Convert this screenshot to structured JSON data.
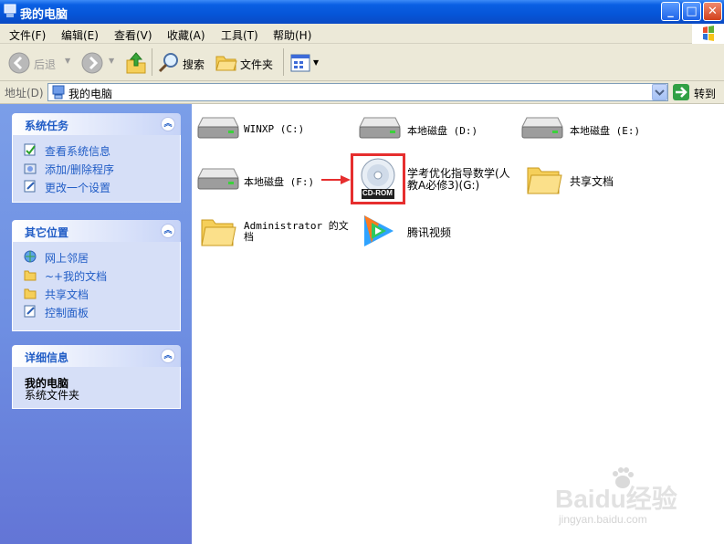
{
  "window": {
    "title": "我的电脑"
  },
  "menu": [
    "文件(F)",
    "编辑(E)",
    "查看(V)",
    "收藏(A)",
    "工具(T)",
    "帮助(H)"
  ],
  "toolbar": {
    "back": "后退",
    "search": "搜索",
    "folders": "文件夹"
  },
  "address": {
    "label": "地址(D)",
    "value": "我的电脑",
    "go": "转到"
  },
  "left": {
    "tasks": {
      "title": "系统任务",
      "items": [
        "查看系统信息",
        "添加/删除程序",
        "更改一个设置"
      ]
    },
    "places": {
      "title": "其它位置",
      "items": [
        "网上邻居",
        "~+我的文档",
        "共享文档",
        "控制面板"
      ]
    },
    "details": {
      "title": "详细信息",
      "name": "我的电脑",
      "desc": "系统文件夹"
    }
  },
  "items": {
    "c": "WINXP (C:)",
    "d": "本地磁盘 (D:)",
    "e": "本地磁盘 (E:)",
    "f": "本地磁盘 (F:)",
    "g_line1": "学考优化指导数学(人",
    "g_line2": "教A必修3)(G:)",
    "cdrom": "CD-ROM",
    "shared": "共享文档",
    "admin_line1": "Administrator 的文",
    "admin_line2": "档",
    "tencent": "腾讯视频"
  },
  "watermark": {
    "brand": "Baidu经验",
    "url": "jingyan.baidu.com"
  },
  "colors": {
    "titlebar": "#0655d8",
    "panel_text": "#215dc6",
    "highlight": "#e62e2e"
  }
}
